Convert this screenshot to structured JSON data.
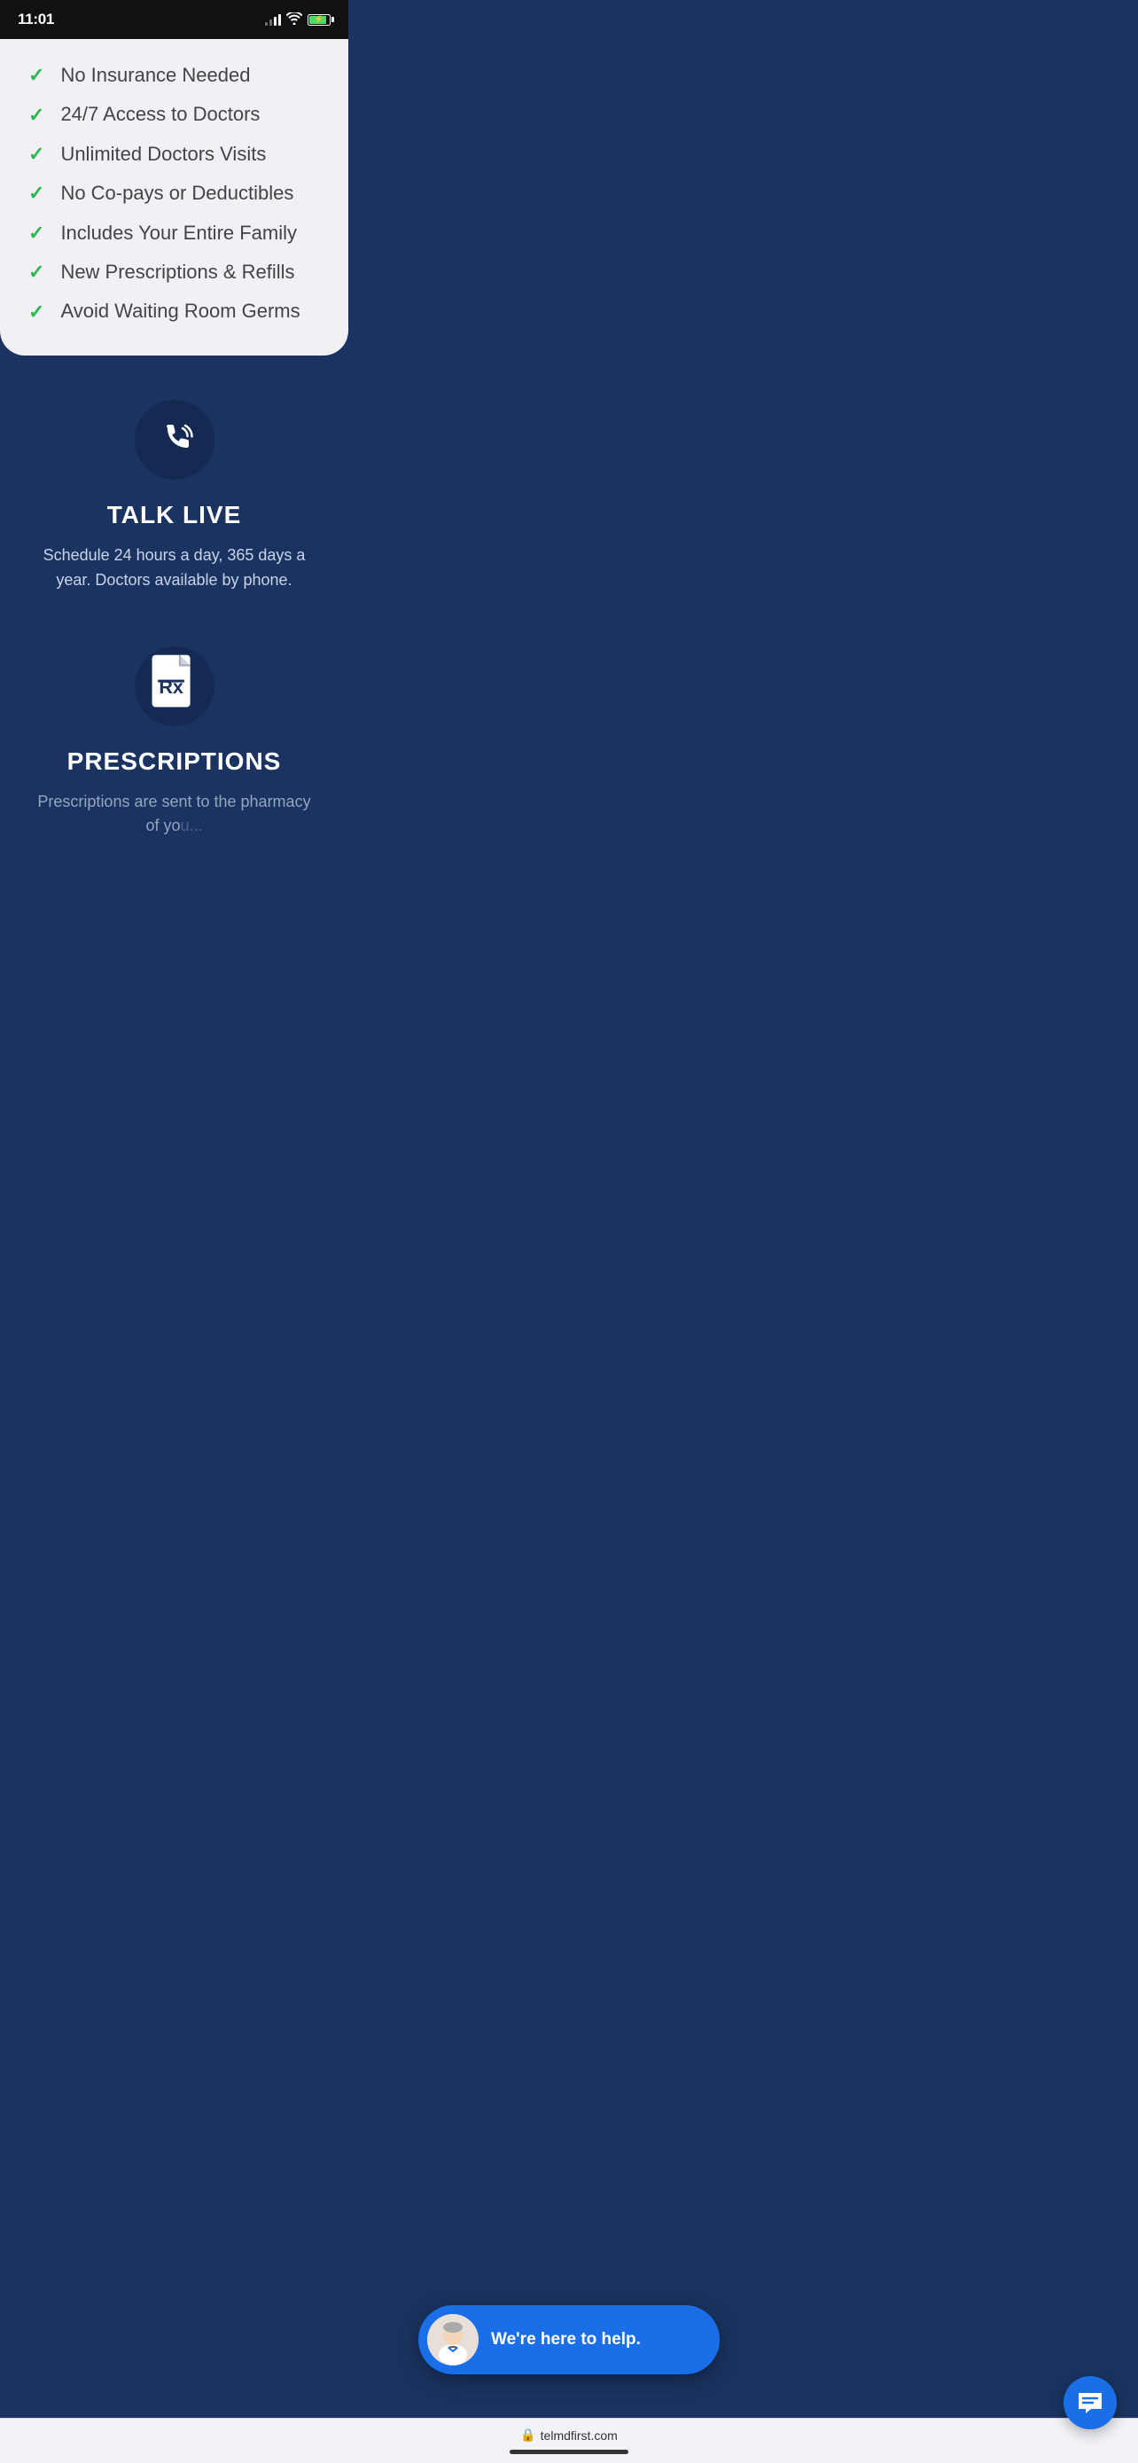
{
  "statusBar": {
    "time": "11:01",
    "url": "telmdfirst.com"
  },
  "features": {
    "items": [
      {
        "id": "no-insurance",
        "text": "No Insurance Needed"
      },
      {
        "id": "access-doctors",
        "text": "24/7 Access to Doctors"
      },
      {
        "id": "unlimited-visits",
        "text": "Unlimited Doctors Visits"
      },
      {
        "id": "no-copays",
        "text": "No Co-pays or Deductibles"
      },
      {
        "id": "entire-family",
        "text": "Includes Your Entire Family"
      },
      {
        "id": "prescriptions",
        "text": "New Prescriptions & Refills"
      },
      {
        "id": "avoid-germs",
        "text": "Avoid Waiting Room Germs"
      }
    ]
  },
  "talkLive": {
    "title": "TALK LIVE",
    "description": "Schedule 24 hours a day, 365 days a year. Doctors available by phone."
  },
  "prescriptions": {
    "title": "PRESCRIPTIONS",
    "description": "Prescriptions are sent to the pharmacy of yo..."
  },
  "chatWidget": {
    "label": "We're here to help.",
    "doctorEmoji": "👨‍⚕️"
  },
  "colors": {
    "checkGreen": "#2db84b",
    "darkBlue": "#1a3360",
    "darkerBlue": "#152a52",
    "chatBlue": "#1a6fe8",
    "cardBg": "#f0f0f5"
  }
}
